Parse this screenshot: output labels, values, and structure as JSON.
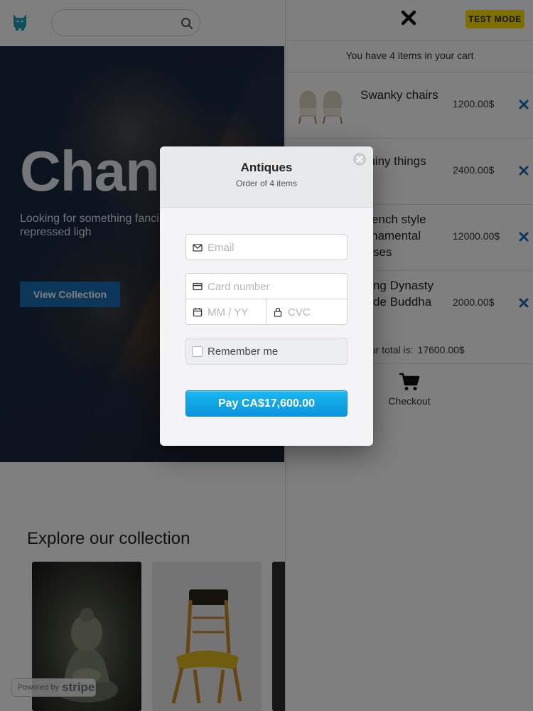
{
  "header": {
    "logo_icon": "cat-logo-icon",
    "search_placeholder": "",
    "search_icon": "search-icon"
  },
  "hero": {
    "title": "Chan",
    "text": "Looking for something fanci less fancy than repressed ligh",
    "button_label": "View Collection"
  },
  "explore": {
    "title": "Explore our collection"
  },
  "stripe_badge": {
    "powered_by": "Powered by",
    "brand": "stripe"
  },
  "cart": {
    "test_mode": "TEST MODE",
    "count_text": "You have 4 items in your cart",
    "items": [
      {
        "name": "Swanky chairs",
        "price": "1200.00$"
      },
      {
        "name": "Shiny things",
        "price": "2400.00$"
      },
      {
        "name": "French style ornamental vases",
        "price": "12000.00$"
      },
      {
        "name": "Ming Dynasty Jade Buddha",
        "price": "2000.00$"
      }
    ],
    "total_label": "Your total is:",
    "total_value": "17600.00$",
    "checkout_label": "Checkout"
  },
  "modal": {
    "title": "Antiques",
    "subtitle": "Order of 4 items",
    "email_placeholder": "Email",
    "card_placeholder": "Card number",
    "expiry_placeholder": "MM / YY",
    "cvc_placeholder": "CVC",
    "remember_label": "Remember me",
    "pay_label": "Pay CA$17,600.00"
  },
  "colors": {
    "accent_blue": "#1a6fb5",
    "pay_blue": "#0a95dc",
    "test_mode_yellow": "#ffde00",
    "remove_blue": "#1a6fb5"
  }
}
